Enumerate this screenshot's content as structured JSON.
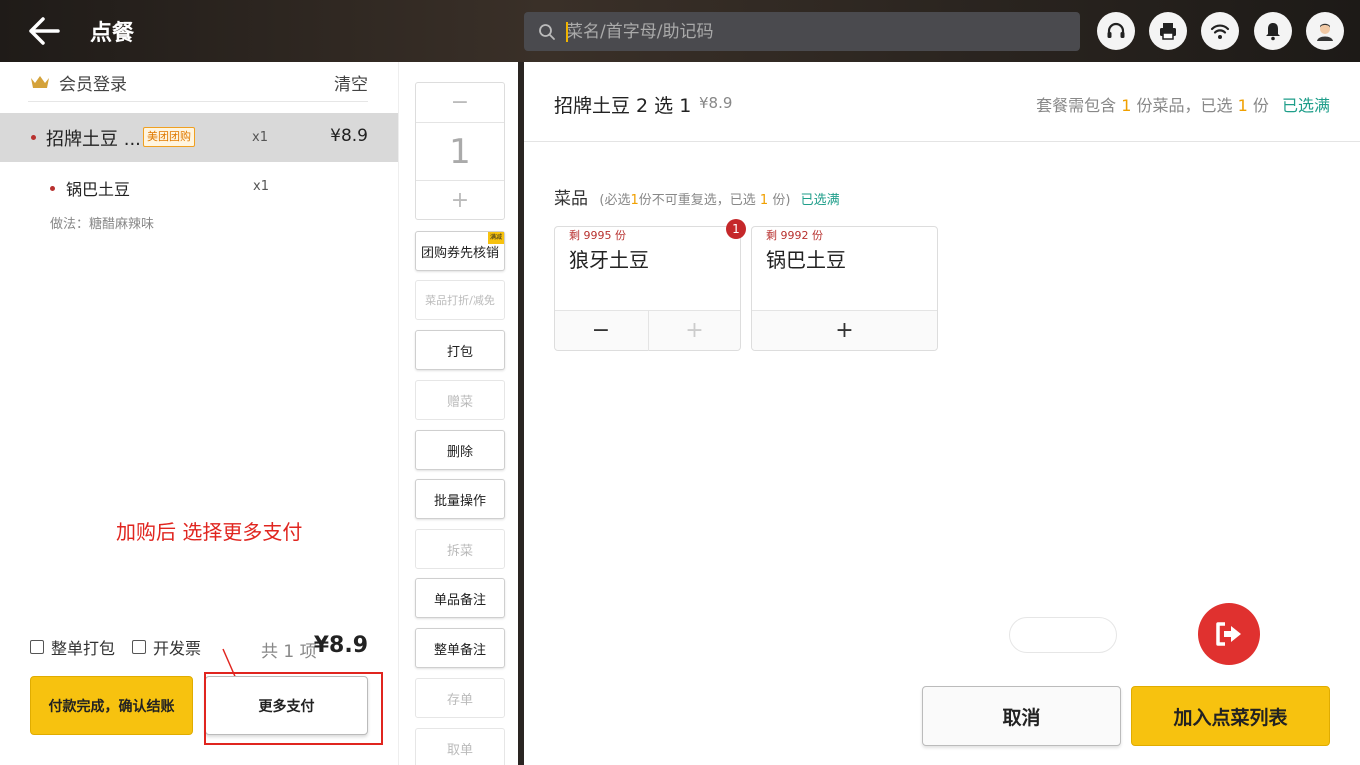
{
  "header": {
    "title": "点餐",
    "search_placeholder": "菜名/首字母/助记码"
  },
  "order": {
    "member_login": "会员登录",
    "clear": "清空",
    "items": [
      {
        "name": "招牌土豆 ...",
        "tag": "美团团购",
        "qty": "x1",
        "price": "¥8.9"
      }
    ],
    "sub_items": [
      {
        "name": "锅巴土豆",
        "qty": "x1",
        "practice": "做法：糖醋麻辣味"
      }
    ],
    "whole_pack": "整单打包",
    "invoice": "开发票",
    "total_count": "共 1 项",
    "total_price": "¥8.9",
    "pay_done": "付款完成，确认结账",
    "more_pay": "更多支付",
    "annotation": "加购后 选择更多支付"
  },
  "ops": {
    "stepper_value": "1",
    "stepper_minus": "−",
    "stepper_plus": "+",
    "buttons": [
      {
        "label": "团购券先核销",
        "tag": "满减"
      },
      {
        "label": "菜品打折/减免"
      },
      {
        "label": "打包"
      },
      {
        "label": "赠菜"
      },
      {
        "label": "删除"
      },
      {
        "label": "批量操作"
      },
      {
        "label": "拆菜"
      },
      {
        "label": "单品备注"
      },
      {
        "label": "整单备注"
      },
      {
        "label": "存单"
      },
      {
        "label": "取单"
      }
    ]
  },
  "combo": {
    "title": "招牌土豆 2 选 1",
    "price": "¥8.9",
    "req_prefix": "套餐需包含",
    "req_count": "1",
    "req_mid": "份菜品，已选",
    "req_selected": "1",
    "req_unit": "份",
    "req_full": "已选满",
    "category": "菜品",
    "cat_prefix": "(必选",
    "cat_count": "1",
    "cat_mid": "份不可重复选，已选",
    "cat_selected": "1",
    "cat_suffix": "份)",
    "cat_full": "已选满",
    "dishes": [
      {
        "stock": "剩 9995 份",
        "name": "狼牙土豆",
        "badge": "1",
        "minus": "−",
        "plus": "+"
      },
      {
        "stock": "剩 9992 份",
        "name": "锅巴土豆",
        "plus": "+"
      }
    ],
    "cancel": "取消",
    "add_to_list": "加入点菜列表"
  },
  "colors": {
    "accent_yellow": "#f7c20f",
    "alert_red": "#e0312f",
    "green_text": "#1f9e8a",
    "orange_text": "#f0a000"
  }
}
